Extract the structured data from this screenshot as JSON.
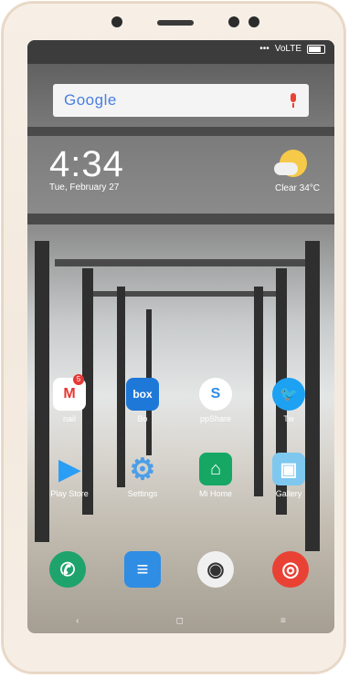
{
  "status": {
    "network": "VoLTE"
  },
  "search": {
    "logo": "Google"
  },
  "clock": {
    "time": "4:34",
    "date": "Tue, February 27"
  },
  "weather": {
    "text": "Clear  34°C"
  },
  "apps_row1": [
    {
      "label": "nail",
      "icon": "gmail-icon",
      "glyph": "M",
      "color": "#ffffff",
      "badge": "5"
    },
    {
      "label": "Bo",
      "icon": "box-icon",
      "glyph": "box",
      "color": "#1e78d7"
    },
    {
      "label": "ppShare",
      "icon": "shareme-icon",
      "glyph": "S",
      "color": "#2f8de4"
    },
    {
      "label": "Tw",
      "icon": "twitter-icon",
      "glyph": "🐦",
      "color": "#1da1f2"
    }
  ],
  "apps_row2": [
    {
      "label": "Play Store",
      "icon": "play-store-icon",
      "glyph": "▶",
      "color": "#2a9df4"
    },
    {
      "label": "Settings",
      "icon": "gear-icon",
      "glyph": "⚙",
      "color": "#4b9ee8"
    },
    {
      "label": "Mi Home",
      "icon": "mi-home-icon",
      "glyph": "⌂",
      "color": "#16a765"
    },
    {
      "label": "Gallery",
      "icon": "gallery-icon",
      "glyph": "▣",
      "color": "#7ec8f0"
    }
  ],
  "dock": [
    {
      "icon": "phone-icon",
      "glyph": "✆",
      "color": "#1ea36c"
    },
    {
      "icon": "messages-icon",
      "glyph": "≡",
      "color": "#2f8de4"
    },
    {
      "icon": "camera-icon",
      "glyph": "◉",
      "color": "#f0f0f0"
    },
    {
      "icon": "chrome-icon",
      "glyph": "◎",
      "color": "#e94235"
    }
  ],
  "nav": {
    "back": "‹",
    "home": "◻",
    "recent": "≡"
  }
}
